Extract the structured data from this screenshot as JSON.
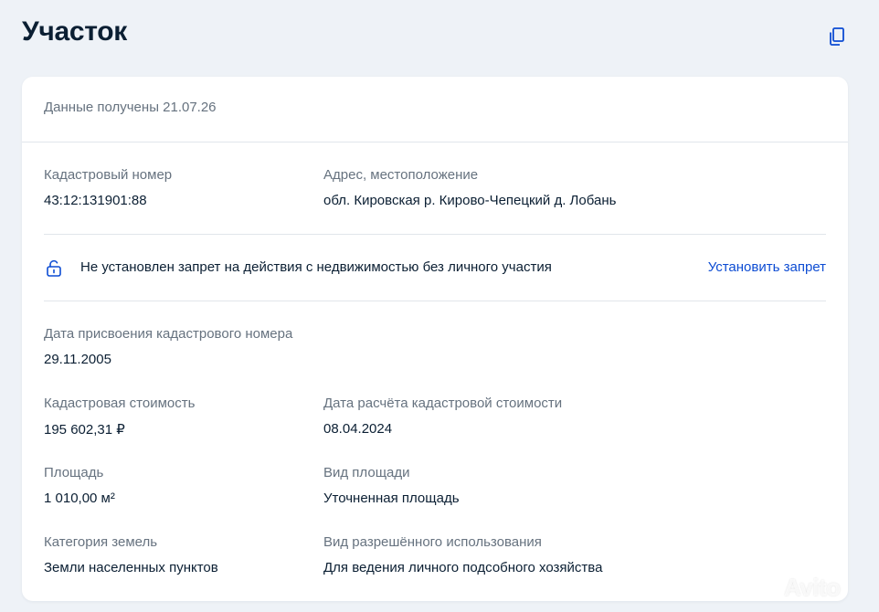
{
  "header": {
    "title": "Участок",
    "copy_icon": "copy-icon"
  },
  "card": {
    "received": "Данные получены 21.07.26",
    "cadastral_number": {
      "label": "Кадастровый номер",
      "value": "43:12:131901:88"
    },
    "address": {
      "label": "Адрес, местоположение",
      "value": "обл. Кировская р. Кирово-Чепецкий д. Лобань"
    },
    "ban": {
      "icon": "lock-icon",
      "text": "Не установлен запрет на действия с недвижимостью без личного участия",
      "link": "Установить запрет"
    },
    "assign_date": {
      "label": "Дата присвоения кадастрового номера",
      "value": "29.11.2005"
    },
    "cadastral_value": {
      "label": "Кадастровая стоимость",
      "value": "195 602,31 ₽"
    },
    "calc_date": {
      "label": "Дата расчёта кадастровой стоимости",
      "value": "08.04.2024"
    },
    "area": {
      "label": "Площадь",
      "value": "1 010,00 м²"
    },
    "area_type": {
      "label": "Вид площади",
      "value": "Уточненная площадь"
    },
    "land_category": {
      "label": "Категория земель",
      "value": "Земли населенных пунктов"
    },
    "permitted_use": {
      "label": "Вид разрешённого использования",
      "value": "Для ведения личного подсобного хозяйства"
    }
  },
  "colors": {
    "background": "#eef2f7",
    "text": "#0b1f33",
    "muted": "#66727f",
    "link": "#0d4cd3",
    "divider": "#e1e6eb"
  },
  "watermark": "Avito"
}
